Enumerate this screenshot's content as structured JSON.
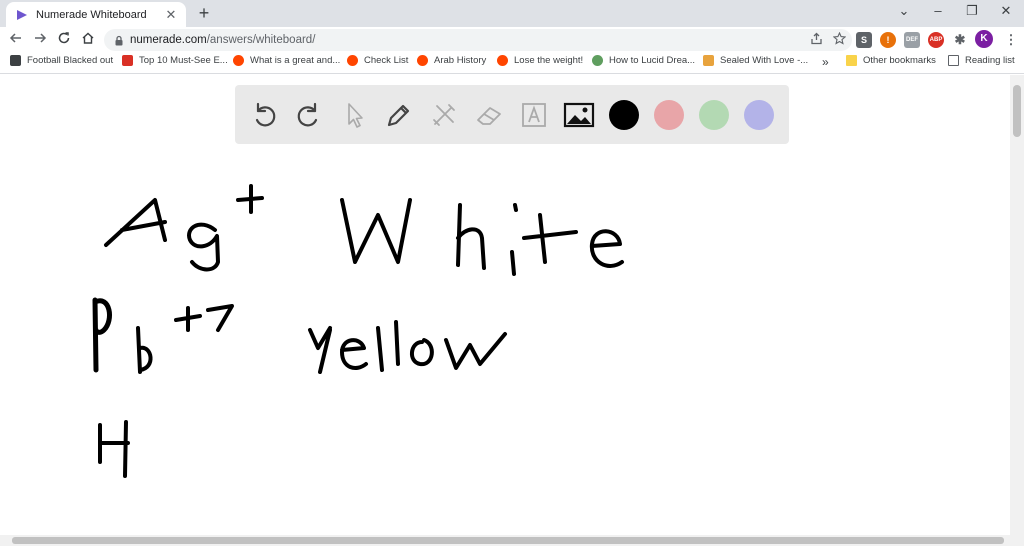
{
  "browser": {
    "tab": {
      "title": "Numerade Whiteboard",
      "close": "✕"
    },
    "new_tab": "+",
    "window_controls": {
      "minimize": "⌄",
      "min2": "–",
      "restore": "❐",
      "close": "✕"
    },
    "url_host": "numerade.com",
    "url_path": "/answers/whiteboard/",
    "profile_initial": "K",
    "extensions": [
      "S",
      "DEF",
      "ABP"
    ]
  },
  "bookmarks": [
    {
      "label": "Football Blacked out",
      "color": "#3c4043"
    },
    {
      "label": "Top 10 Must-See E...",
      "color": "#d93025"
    },
    {
      "label": "What is a great and...",
      "color": "#ff4500"
    },
    {
      "label": "Check List",
      "color": "#ff4500"
    },
    {
      "label": "Arab History",
      "color": "#ff4500"
    },
    {
      "label": "Lose the weight!",
      "color": "#ff4500"
    },
    {
      "label": "How to Lucid Drea...",
      "color": "#5f9e5f"
    },
    {
      "label": "Sealed With Love -...",
      "color": "#e8a33d"
    }
  ],
  "bookmarks_more": "»",
  "other_bookmarks": "Other bookmarks",
  "reading_list": "Reading list",
  "whiteboard": {
    "tools": [
      "undo-icon",
      "redo-icon",
      "select-icon",
      "pen-icon",
      "tools-icon",
      "eraser-icon",
      "text-icon",
      "image-icon"
    ],
    "colors": [
      "#000000",
      "#e8a5a8",
      "#b3d9b3",
      "#b3b3e8"
    ]
  }
}
